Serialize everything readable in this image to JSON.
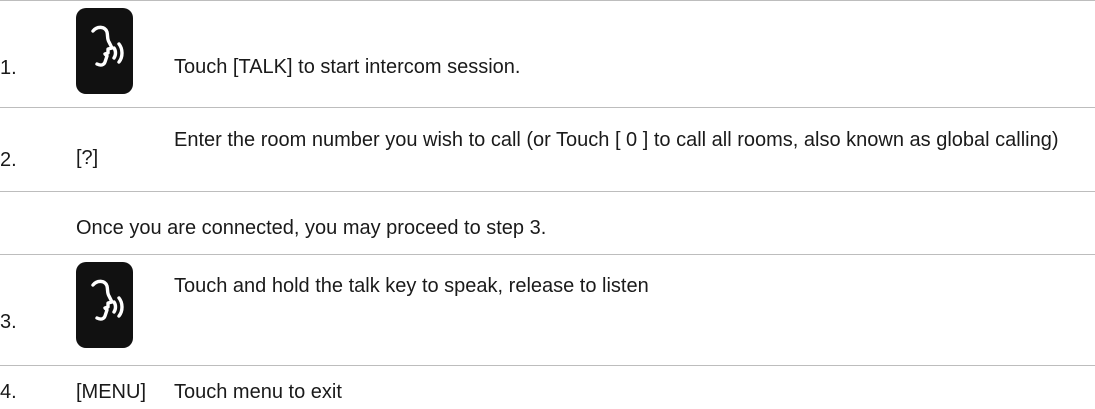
{
  "steps": [
    {
      "number": "1.",
      "icon": "talk-key-icon",
      "text": "Touch [TALK] to start intercom session."
    },
    {
      "number": "2.",
      "key": "[?]",
      "text": "Enter the room number you wish to call (or Touch [ 0 ] to call all rooms, also known as global calling)"
    },
    {
      "number": "3.",
      "icon": "talk-key-icon",
      "text": "Touch and hold the talk key to speak, release to listen"
    },
    {
      "number": "4.",
      "key": "[MENU]",
      "text": "Touch menu to exit"
    }
  ],
  "note": "Once you are connected, you may proceed to step 3.",
  "colors": {
    "text": "#1a1a1a",
    "rule": "#bdbdbd",
    "icon_background": "#111111",
    "icon_glyph": "#ffffff"
  }
}
